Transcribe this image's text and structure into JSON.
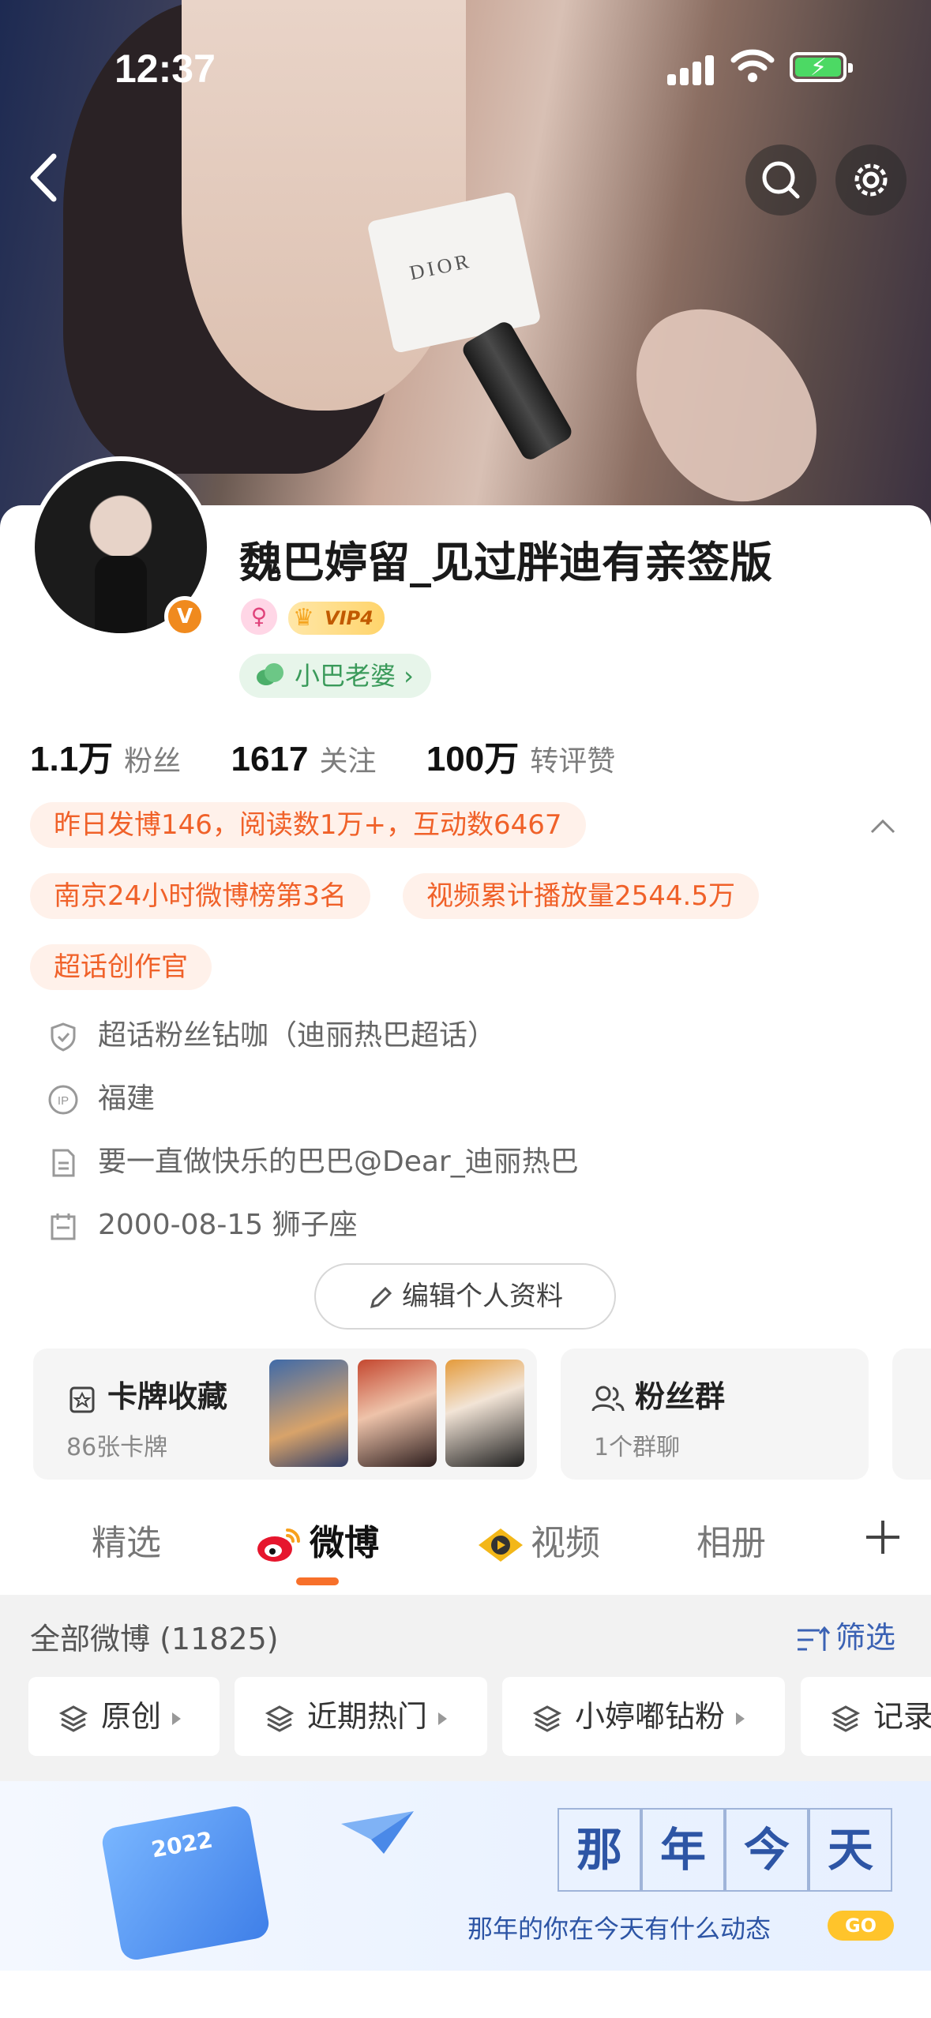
{
  "status": {
    "time": "12:37"
  },
  "profile": {
    "name": "魏巴婷留_见过胖迪有亲签版",
    "vip_label": "VIP4",
    "verified_mark": "V",
    "tag_label": "小巴老婆 ›"
  },
  "stats": [
    {
      "value": "1.1万",
      "label": "粉丝"
    },
    {
      "value": "1617",
      "label": "关注"
    },
    {
      "value": "100万",
      "label": "转评赞"
    }
  ],
  "highlights": {
    "yesterday": "昨日发博146，阅读数1万+，互动数6467",
    "ranking": "南京24小时微博榜第3名",
    "video": "视频累计播放量2544.5万",
    "creator": "超话创作官"
  },
  "info": {
    "fan_level": "超话粉丝钻咖（迪丽热巴超话）",
    "ip": "福建",
    "bio": "要一直做快乐的巴巴@Dear_迪丽热巴",
    "birthday": "2000-08-15 狮子座"
  },
  "edit_button": "编辑个人资料",
  "tiles": {
    "cards": {
      "title": "卡牌收藏",
      "sub": "86张卡牌"
    },
    "group": {
      "title": "粉丝群",
      "sub": "1个群聊"
    }
  },
  "tabs": [
    "精选",
    "微博",
    "视频",
    "相册"
  ],
  "feed": {
    "all_label": "全部微博 (11825)",
    "filter_label": "筛选",
    "chips": [
      "原创",
      "近期热门",
      "小婷嘟钻粉",
      "记录"
    ]
  },
  "banner": {
    "chars": [
      "那",
      "年",
      "今",
      "天"
    ],
    "subtitle": "那年的你在今天有什么动态",
    "go": "GO",
    "year": "2022"
  },
  "colors": {
    "accent": "#f7702a",
    "pill_text": "#f06129",
    "pill_bg": "#fff1ea",
    "link_blue": "#3b62b4"
  }
}
